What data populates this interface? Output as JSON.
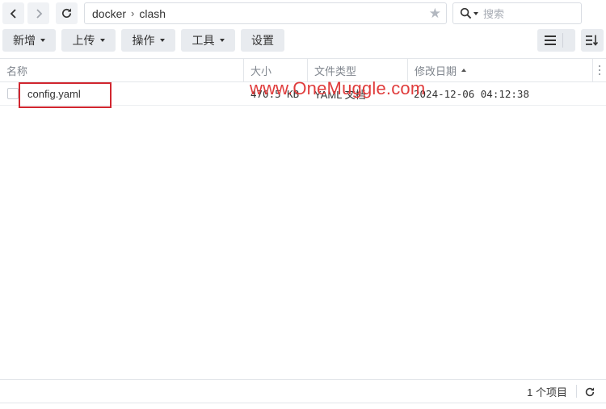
{
  "nav": {
    "back_icon": "chevron-left-icon",
    "forward_icon": "chevron-right-icon",
    "refresh_icon": "refresh-icon"
  },
  "path": {
    "segments": [
      "docker",
      "clash"
    ],
    "separator": "›",
    "favorite_icon": "star-icon"
  },
  "search": {
    "placeholder": "搜索",
    "icon": "search-icon"
  },
  "toolbar": {
    "new_label": "新增",
    "upload_label": "上传",
    "action_label": "操作",
    "tools_label": "工具",
    "settings_label": "设置",
    "list_view_icon": "list-view-icon",
    "sort_icon": "sort-icon"
  },
  "columns": {
    "name": "名称",
    "size": "大小",
    "type": "文件类型",
    "modified": "修改日期"
  },
  "files": [
    {
      "name": "config.yaml",
      "size": "470.5 KB",
      "type": "YAML 文档",
      "modified": "2024-12-06 04:12:38"
    }
  ],
  "watermark": "www.OneMuggle.com",
  "status": {
    "count": "1 个项目"
  },
  "colors": {
    "accent_red": "#d1262f",
    "watermark_red": "#e03c3c",
    "button_bg": "#e8ebef"
  }
}
